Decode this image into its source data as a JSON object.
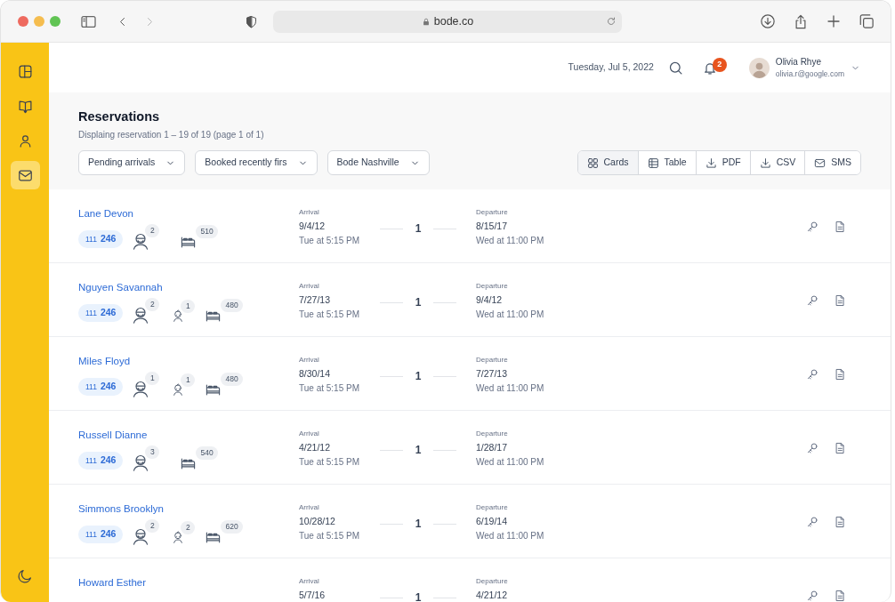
{
  "browser": {
    "url": "bode.co"
  },
  "sidebar": {
    "items": [
      {
        "selected": false
      },
      {
        "selected": false
      },
      {
        "selected": false
      },
      {
        "selected": true
      }
    ]
  },
  "header": {
    "date": "Tuesday, Jul 5, 2022",
    "notifications": "2",
    "user": {
      "name": "Olivia Rhye",
      "email": "olivia.r@google.com"
    }
  },
  "page": {
    "title": "Reservations",
    "subtitle": "Displaing reservation 1 – 19 of 19 (page 1 of 1)",
    "filters": [
      "Pending arrivals",
      "Booked recently firs",
      "Bode Nashville"
    ],
    "toolbar": [
      {
        "label": "Cards",
        "selected": true
      },
      {
        "label": "Table",
        "selected": false
      },
      {
        "label": "PDF",
        "selected": false
      },
      {
        "label": "CSV",
        "selected": false
      },
      {
        "label": "SMS",
        "selected": false
      }
    ]
  },
  "rows": [
    {
      "name": "Lane Devon",
      "room_prefix": "111",
      "room": "246",
      "guests": [
        {
          "kind": "adult",
          "count": "2"
        },
        {
          "kind": "bed",
          "count": "510"
        }
      ],
      "arrival_label": "Arrival",
      "arrival_date": "9/4/12",
      "arrival_time": "Tue at 5:15 PM",
      "nights": "1",
      "departure_label": "Departure",
      "departure_date": "8/15/17",
      "departure_time": "Wed at 11:00 PM"
    },
    {
      "name": "Nguyen Savannah",
      "room_prefix": "111",
      "room": "246",
      "guests": [
        {
          "kind": "adult",
          "count": "2"
        },
        {
          "kind": "child",
          "count": "1"
        },
        {
          "kind": "bed",
          "count": "480"
        }
      ],
      "arrival_label": "Arrival",
      "arrival_date": "7/27/13",
      "arrival_time": "Tue at 5:15 PM",
      "nights": "1",
      "departure_label": "Departure",
      "departure_date": "9/4/12",
      "departure_time": "Wed at 11:00 PM"
    },
    {
      "name": "Miles Floyd",
      "room_prefix": "111",
      "room": "246",
      "guests": [
        {
          "kind": "adult",
          "count": "1"
        },
        {
          "kind": "child",
          "count": "1"
        },
        {
          "kind": "bed",
          "count": "480"
        }
      ],
      "arrival_label": "Arrival",
      "arrival_date": "8/30/14",
      "arrival_time": "Tue at 5:15 PM",
      "nights": "1",
      "departure_label": "Departure",
      "departure_date": "7/27/13",
      "departure_time": "Wed at 11:00 PM"
    },
    {
      "name": "Russell Dianne",
      "room_prefix": "111",
      "room": "246",
      "guests": [
        {
          "kind": "adult",
          "count": "3"
        },
        {
          "kind": "bed",
          "count": "540"
        }
      ],
      "arrival_label": "Arrival",
      "arrival_date": "4/21/12",
      "arrival_time": "Tue at 5:15 PM",
      "nights": "1",
      "departure_label": "Departure",
      "departure_date": "1/28/17",
      "departure_time": "Wed at 11:00 PM"
    },
    {
      "name": "Simmons Brooklyn",
      "room_prefix": "111",
      "room": "246",
      "guests": [
        {
          "kind": "adult",
          "count": "2"
        },
        {
          "kind": "child",
          "count": "2"
        },
        {
          "kind": "bed",
          "count": "620"
        }
      ],
      "arrival_label": "Arrival",
      "arrival_date": "10/28/12",
      "arrival_time": "Tue at 5:15 PM",
      "nights": "1",
      "departure_label": "Departure",
      "departure_date": "6/19/14",
      "departure_time": "Wed at 11:00 PM"
    },
    {
      "name": "Howard Esther",
      "arrival_label": "Arrival",
      "arrival_date": "5/7/16",
      "nights": "1",
      "departure_label": "Departure",
      "departure_date": "4/21/12"
    }
  ]
}
